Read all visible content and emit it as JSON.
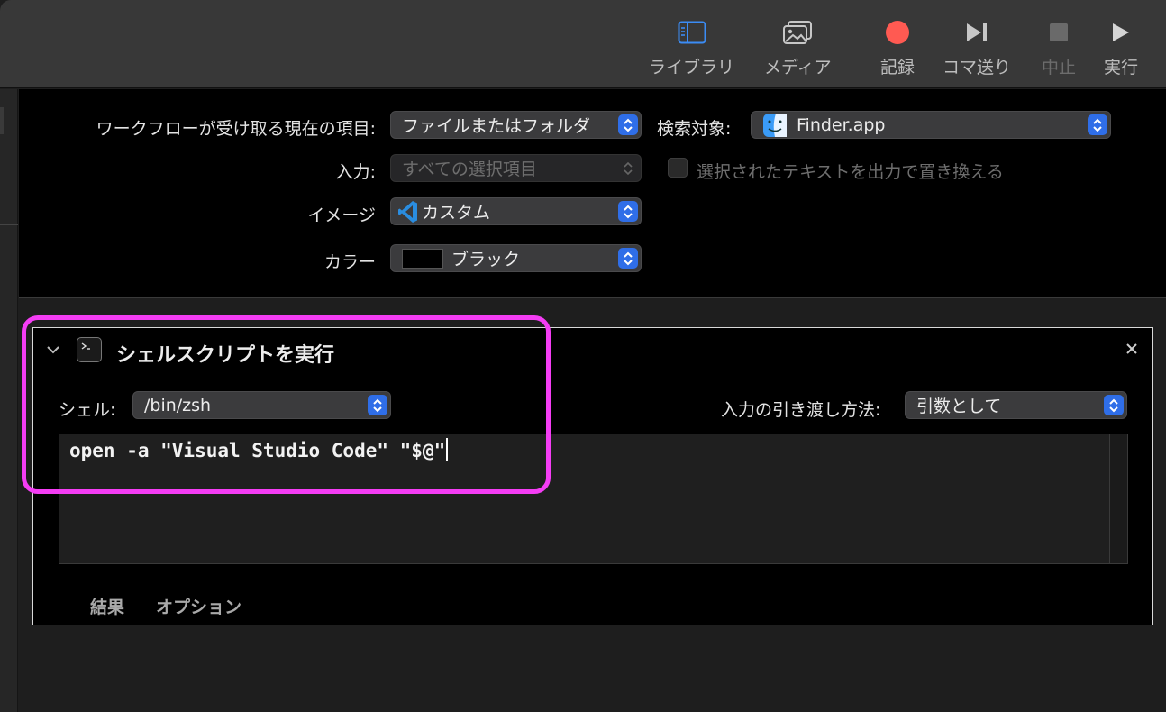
{
  "toolbar": {
    "library": "ライブラリ",
    "media": "メディア",
    "record": "記録",
    "step": "コマ送り",
    "stop": "中止",
    "run": "実行"
  },
  "colors": {
    "accent": "#2f6ee8",
    "record": "#ff5a52",
    "highlight": "#f43df4"
  },
  "settings": {
    "receives_label": "ワークフローが受け取る現在の項目:",
    "receives_value": "ファイルまたはフォルダ",
    "search_label": "検索対象:",
    "search_value": "Finder.app",
    "input_label": "入力:",
    "input_value": "すべての選択項目",
    "replace_label": "選択されたテキストを出力で置き換える",
    "image_label": "イメージ",
    "image_value": "カスタム",
    "color_label": "カラー",
    "color_value": "ブラック"
  },
  "action": {
    "title": "シェルスクリプトを実行",
    "shell_label": "シェル:",
    "shell_value": "/bin/zsh",
    "pass_label": "入力の引き渡し方法:",
    "pass_value": "引数として",
    "script": "open -a \"Visual Studio Code\" \"$@\"",
    "tab_results": "結果",
    "tab_options": "オプション"
  }
}
